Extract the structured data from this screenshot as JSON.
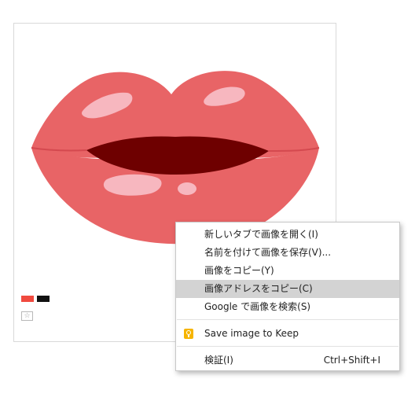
{
  "colors": {
    "swatch_1": "#f04a3f",
    "swatch_2": "#111111",
    "lip_main": "#e86466",
    "lip_shadow": "#d4494f",
    "mouth": "#6e0000",
    "highlight": "#f7b7bf",
    "menu_highlight": "#d3d3d3",
    "keep_icon": "#f6b400"
  },
  "image": {
    "icon": "lips-illustration"
  },
  "context_menu": {
    "items": [
      {
        "label": "新しいタブで画像を開く(I)"
      },
      {
        "label": "名前を付けて画像を保存(V)..."
      },
      {
        "label": "画像をコピー(Y)"
      },
      {
        "label": "画像アドレスをコピー(C)",
        "highlighted": true
      },
      {
        "label": "Google で画像を検索(S)"
      }
    ],
    "keep": {
      "label": "Save image to Keep",
      "icon": "keep-icon"
    },
    "inspect": {
      "label": "検証(I)",
      "shortcut": "Ctrl+Shift+I"
    }
  }
}
